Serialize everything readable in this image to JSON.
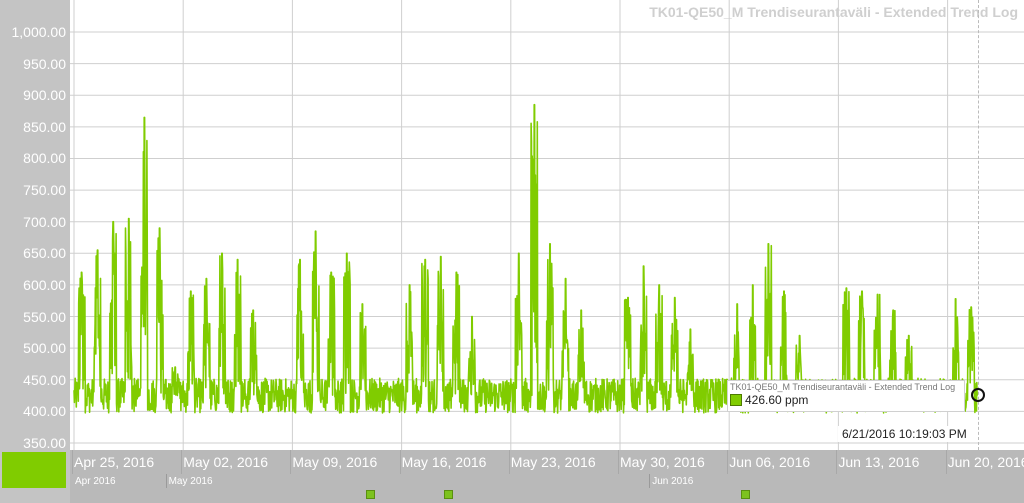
{
  "chart_data": {
    "type": "line",
    "title": "TK01-QE50_M Trendiseurantaväli - Extended Trend Log",
    "y_ticks": [
      "1,000.00",
      "950.00",
      "900.00",
      "850.00",
      "800.00",
      "750.00",
      "700.00",
      "650.00",
      "600.00",
      "550.00",
      "500.00",
      "450.00",
      "400.00",
      "350.00"
    ],
    "ylim": [
      350,
      1000
    ],
    "x_ticks": [
      "Apr 25, 2016",
      "May 02, 2016",
      "May 09, 2016",
      "May 16, 2016",
      "May 23, 2016",
      "May 30, 2016",
      "Jun 06, 2016",
      "Jun 13, 2016",
      "Jun 20, 2016"
    ],
    "xlim": [
      "2016-04-25",
      "2016-06-21"
    ],
    "grid": true,
    "series": [
      {
        "color": "#80cc00",
        "baseline": 425,
        "peaks": [
          {
            "date": "2016-04-25",
            "value": 620
          },
          {
            "date": "2016-04-26",
            "value": 655
          },
          {
            "date": "2016-04-27",
            "value": 700
          },
          {
            "date": "2016-04-28",
            "value": 705
          },
          {
            "date": "2016-04-29",
            "value": 865
          },
          {
            "date": "2016-04-30",
            "value": 690
          },
          {
            "date": "2016-05-01",
            "value": 470
          },
          {
            "date": "2016-05-02",
            "value": 590
          },
          {
            "date": "2016-05-03",
            "value": 610
          },
          {
            "date": "2016-05-04",
            "value": 650
          },
          {
            "date": "2016-05-05",
            "value": 640
          },
          {
            "date": "2016-05-06",
            "value": 560
          },
          {
            "date": "2016-05-09",
            "value": 640
          },
          {
            "date": "2016-05-10",
            "value": 685
          },
          {
            "date": "2016-05-11",
            "value": 620
          },
          {
            "date": "2016-05-12",
            "value": 650
          },
          {
            "date": "2016-05-13",
            "value": 570
          },
          {
            "date": "2016-05-16",
            "value": 600
          },
          {
            "date": "2016-05-17",
            "value": 640
          },
          {
            "date": "2016-05-18",
            "value": 645
          },
          {
            "date": "2016-05-19",
            "value": 620
          },
          {
            "date": "2016-05-20",
            "value": 550
          },
          {
            "date": "2016-05-23",
            "value": 650
          },
          {
            "date": "2016-05-24",
            "value": 885
          },
          {
            "date": "2016-05-25",
            "value": 665
          },
          {
            "date": "2016-05-26",
            "value": 610
          },
          {
            "date": "2016-05-27",
            "value": 560
          },
          {
            "date": "2016-05-30",
            "value": 580
          },
          {
            "date": "2016-05-31",
            "value": 630
          },
          {
            "date": "2016-06-01",
            "value": 600
          },
          {
            "date": "2016-06-02",
            "value": 580
          },
          {
            "date": "2016-06-03",
            "value": 530
          },
          {
            "date": "2016-06-06",
            "value": 570
          },
          {
            "date": "2016-06-07",
            "value": 600
          },
          {
            "date": "2016-06-08",
            "value": 665
          },
          {
            "date": "2016-06-09",
            "value": 590
          },
          {
            "date": "2016-06-10",
            "value": 520
          },
          {
            "date": "2016-06-13",
            "value": 595
          },
          {
            "date": "2016-06-14",
            "value": 590
          },
          {
            "date": "2016-06-15",
            "value": 585
          },
          {
            "date": "2016-06-16",
            "value": 560
          },
          {
            "date": "2016-06-17",
            "value": 520
          },
          {
            "date": "2016-06-20",
            "value": 578
          },
          {
            "date": "2016-06-21",
            "value": 565
          }
        ]
      }
    ]
  },
  "overview": {
    "labels": [
      {
        "text": "Apr 2016",
        "date": "2016-04-25"
      },
      {
        "text": "May 2016",
        "date": "2016-05-01"
      },
      {
        "text": "Jun 2016",
        "date": "2016-06-01"
      }
    ],
    "markers": [
      "2016-05-14",
      "2016-05-19",
      "2016-06-07"
    ]
  },
  "tooltip": {
    "title": "TK01-QE50_M Trendiseurantaväli - Extended Trend Log",
    "value": "426.60 ppm",
    "time": "6/21/2016 10:19:03 PM",
    "date": "2016-06-21",
    "cursor_value": 426.6
  }
}
